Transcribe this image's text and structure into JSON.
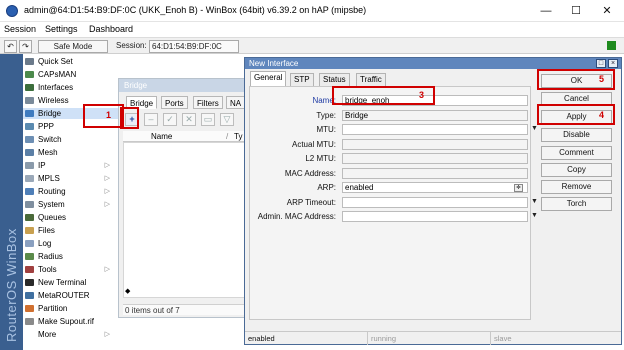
{
  "window": {
    "title": "admin@64:D1:54:B9:DF:0C (UKK_Enoh B) - WinBox (64bit) v6.39.2 on hAP (mipsbe)",
    "min_glyph": "—",
    "max_glyph": "☐",
    "close_glyph": "✕"
  },
  "menubar": {
    "items": [
      "Session",
      "Settings",
      "Dashboard"
    ]
  },
  "toolbar": {
    "undo_glyph": "↶",
    "redo_glyph": "↷",
    "safe_mode_label": "Safe Mode",
    "session_label": "Session:",
    "session_value": "64:D1:54:B9:DF:0C",
    "status_color": "#1e8a1e"
  },
  "brand": {
    "text": "RouterOS WinBox"
  },
  "sidebar": {
    "items": [
      {
        "label": "Quick Set",
        "icon": "quickset-icon",
        "color": "#6b7a8a",
        "arrow": ""
      },
      {
        "label": "CAPsMAN",
        "icon": "capsman-icon",
        "color": "#4c8a4c",
        "arrow": ""
      },
      {
        "label": "Interfaces",
        "icon": "interfaces-icon",
        "color": "#3c6e3c",
        "arrow": ""
      },
      {
        "label": "Wireless",
        "icon": "wireless-icon",
        "color": "#7a8a9a",
        "arrow": ""
      },
      {
        "label": "Bridge",
        "icon": "bridge-icon",
        "color": "#3f7bbf",
        "arrow": ""
      },
      {
        "label": "PPP",
        "icon": "ppp-icon",
        "color": "#5a8ab0",
        "arrow": ""
      },
      {
        "label": "Switch",
        "icon": "switch-icon",
        "color": "#6d8fb4",
        "arrow": ""
      },
      {
        "label": "Mesh",
        "icon": "mesh-icon",
        "color": "#5b7fa6",
        "arrow": ""
      },
      {
        "label": "IP",
        "icon": "ip-icon",
        "color": "#8a9aaa",
        "arrow": "▷"
      },
      {
        "label": "MPLS",
        "icon": "mpls-icon",
        "color": "#9aa8b8",
        "arrow": "▷"
      },
      {
        "label": "Routing",
        "icon": "routing-icon",
        "color": "#4f7fb8",
        "arrow": "▷"
      },
      {
        "label": "System",
        "icon": "system-icon",
        "color": "#7f8f9f",
        "arrow": "▷"
      },
      {
        "label": "Queues",
        "icon": "queues-icon",
        "color": "#4a6a3a",
        "arrow": ""
      },
      {
        "label": "Files",
        "icon": "files-icon",
        "color": "#c8a050",
        "arrow": ""
      },
      {
        "label": "Log",
        "icon": "log-icon",
        "color": "#8aa0c0",
        "arrow": ""
      },
      {
        "label": "Radius",
        "icon": "radius-icon",
        "color": "#5a8a4a",
        "arrow": ""
      },
      {
        "label": "Tools",
        "icon": "tools-icon",
        "color": "#a04040",
        "arrow": "▷"
      },
      {
        "label": "New Terminal",
        "icon": "terminal-icon",
        "color": "#2a2a2a",
        "arrow": ""
      },
      {
        "label": "MetaROUTER",
        "icon": "metarouter-icon",
        "color": "#3f6fa0",
        "arrow": ""
      },
      {
        "label": "Partition",
        "icon": "partition-icon",
        "color": "#d07030",
        "arrow": ""
      },
      {
        "label": "Make Supout.rif",
        "icon": "supout-icon",
        "color": "#8a8a8a",
        "arrow": ""
      },
      {
        "label": "More",
        "icon": "more-icon",
        "color": "#ffffff",
        "arrow": "▷"
      }
    ]
  },
  "bridge_window": {
    "title": "Bridge",
    "tabs": [
      "Bridge",
      "Ports",
      "Filters",
      "NA"
    ],
    "column_name": "Name",
    "column_sort": "/",
    "column_type": "Ty",
    "add_glyph": "+",
    "status": "0 items out of 7",
    "scroll_glyph": "◆"
  },
  "dialog": {
    "title": "New Interface",
    "restore_glyph": "□",
    "close_glyph": "×",
    "tabs": [
      "General",
      "STP",
      "Status",
      "Traffic"
    ],
    "fields": {
      "name_label": "Name:",
      "name_value": "bridge_enoh",
      "type_label": "Type:",
      "type_value": "Bridge",
      "mtu_label": "MTU:",
      "mtu_value": "",
      "actual_mtu_label": "Actual MTU:",
      "actual_mtu_value": "",
      "l2mtu_label": "L2 MTU:",
      "l2mtu_value": "",
      "mac_label": "MAC Address:",
      "mac_value": "",
      "arp_label": "ARP:",
      "arp_value": "enabled",
      "arp_timeout_label": "ARP Timeout:",
      "arp_timeout_value": "",
      "admin_mac_label": "Admin. MAC Address:",
      "admin_mac_value": ""
    },
    "dropdown_glyph": "▼",
    "spin_glyph": "≑",
    "buttons": {
      "ok": "OK",
      "cancel": "Cancel",
      "apply": "Apply",
      "disable": "Disable",
      "comment": "Comment",
      "copy": "Copy",
      "remove": "Remove",
      "torch": "Torch"
    },
    "status": [
      "enabled",
      "running",
      "slave"
    ]
  },
  "annotations": {
    "step1": "1",
    "step3": "3",
    "step4": "4",
    "step5": "5",
    "color": "#d00000"
  }
}
